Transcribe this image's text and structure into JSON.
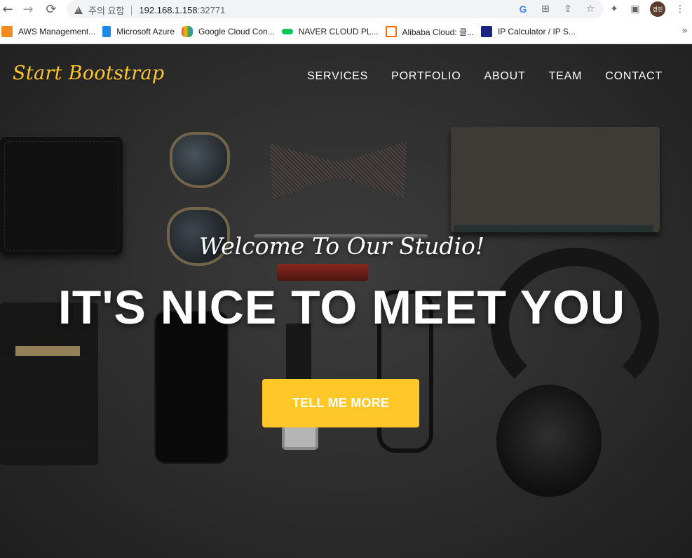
{
  "browser": {
    "security_label": "주의 요함",
    "url_host": "192.168.1.158",
    "url_port": ":32771",
    "profile_initials": "경민",
    "icons": [
      "back-arrow-icon",
      "forward-arrow-icon",
      "reload-icon",
      "warning-icon",
      "google-icon",
      "translate-icon",
      "share-icon",
      "star-icon",
      "extensions-icon",
      "side-panel-icon",
      "more-vert-icon"
    ]
  },
  "bookmarks": [
    {
      "label": "AWS Management...",
      "icon": "aws-icon",
      "color": "#f28b1e"
    },
    {
      "label": "Microsoft Azure",
      "icon": "azure-icon",
      "color": "#1e88e5"
    },
    {
      "label": "Google Cloud Con...",
      "icon": "gcp-icon",
      "color": "#ea4335"
    },
    {
      "label": "NAVER CLOUD PL...",
      "icon": "naver-cloud-icon",
      "color": "#03c75a"
    },
    {
      "label": "Alibaba Cloud: 클...",
      "icon": "alibaba-icon",
      "color": "#ff6a00"
    },
    {
      "label": "IP Calculator / IP S...",
      "icon": "ip-calculator-icon",
      "color": "#1a237e"
    }
  ],
  "bookmarks_more": "»",
  "site": {
    "brand": "Start Bootstrap",
    "nav": [
      "SERVICES",
      "PORTFOLIO",
      "ABOUT",
      "TEAM",
      "CONTACT"
    ],
    "hero_subheading": "Welcome To Our Studio!",
    "hero_heading": "IT'S NICE TO MEET YOU",
    "cta_label": "TELL ME MORE"
  },
  "colors": {
    "accent": "#ffc828",
    "hero_text": "#ffffff"
  }
}
